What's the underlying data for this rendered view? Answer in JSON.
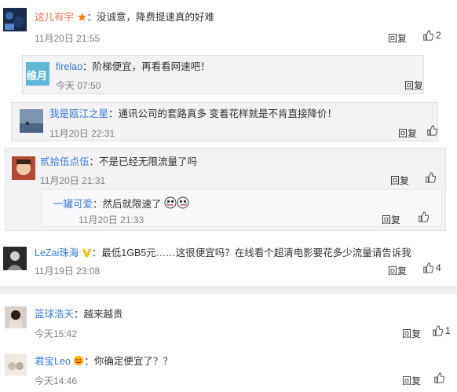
{
  "comments": [
    {
      "name": "这儿有宇",
      "badge": "star-badge-icon",
      "content": "没诚意，降费提速真的好难",
      "time": "11月20日 21:55",
      "reply_label": "回复",
      "like_count": "2"
    },
    {
      "name": "firelao",
      "content": "阶梯便宜，再看看网速吧！",
      "time": "今天 07:50",
      "reply_label": "回复",
      "avatar_text": "维月"
    },
    {
      "name": "我是瓯江之星",
      "content": "通讯公司的套路真多 变着花样就是不肯直接降价！",
      "time": "11月20日 22:31",
      "reply_label": "回复"
    },
    {
      "name": "贰拾伍点伍",
      "content": "不是已经无限流量了吗",
      "time": "11月20日 21:31",
      "reply_label": "回复"
    },
    {
      "name": "一罐可爱",
      "content": "然后就限速了",
      "time": "11月20日 21:33",
      "reply_label": "回复"
    },
    {
      "name": "LeZai珠海",
      "badge": "vip-v-badge-icon",
      "content": "最低1GB5元……这很便宜吗？在线看个超清电影要花多少流量请告诉我",
      "time": "11月19日 23:08",
      "reply_label": "回复",
      "like_count": "4"
    },
    {
      "name": "篮球浩天",
      "content": "越来越贵",
      "time": "今天15:42",
      "reply_label": "回复",
      "like_count": "1"
    },
    {
      "name": "君宝Leo",
      "content": "你确定便宜了？？",
      "time": "今天14:46",
      "reply_label": "回复"
    }
  ],
  "colors": {
    "username": "#eb7350",
    "username_sub": "#3c7bd8",
    "time": "#808080",
    "badge_star": "#ff8200",
    "badge_v": "#ffc200"
  }
}
